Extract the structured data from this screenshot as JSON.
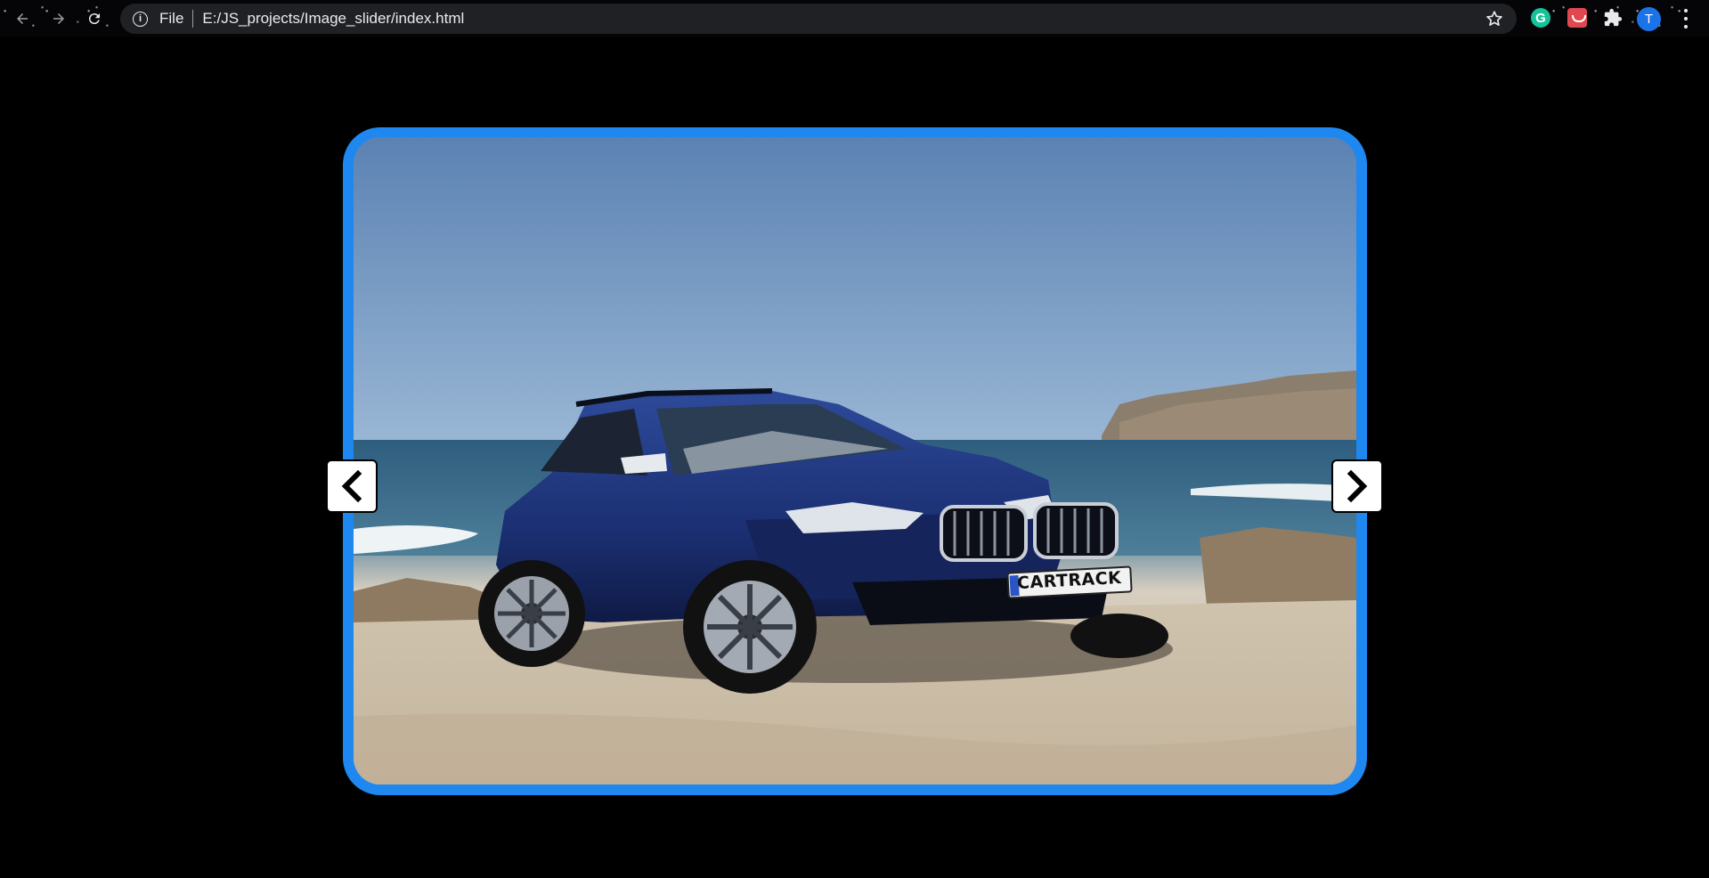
{
  "browser": {
    "omnibox": {
      "scheme_label": "File",
      "url": "E:/JS_projects/Image_slider/index.html"
    },
    "profile_initial": "T",
    "grammarly_letter": "G",
    "icons": {
      "back": "arrow-left-icon",
      "forward": "arrow-right-icon",
      "reload": "reload-icon",
      "info": "info-icon",
      "bookmark": "star-icon",
      "extensions": "puzzle-icon",
      "menu": "kebab-menu-icon"
    }
  },
  "slider": {
    "frame_color": "#1e88f0",
    "slide": {
      "subject": "blue SUV parked on a sandy beach by the sea",
      "plate_text": "CARTRACK"
    },
    "prev_icon": "chevron-left-icon",
    "next_icon": "chevron-right-icon"
  }
}
